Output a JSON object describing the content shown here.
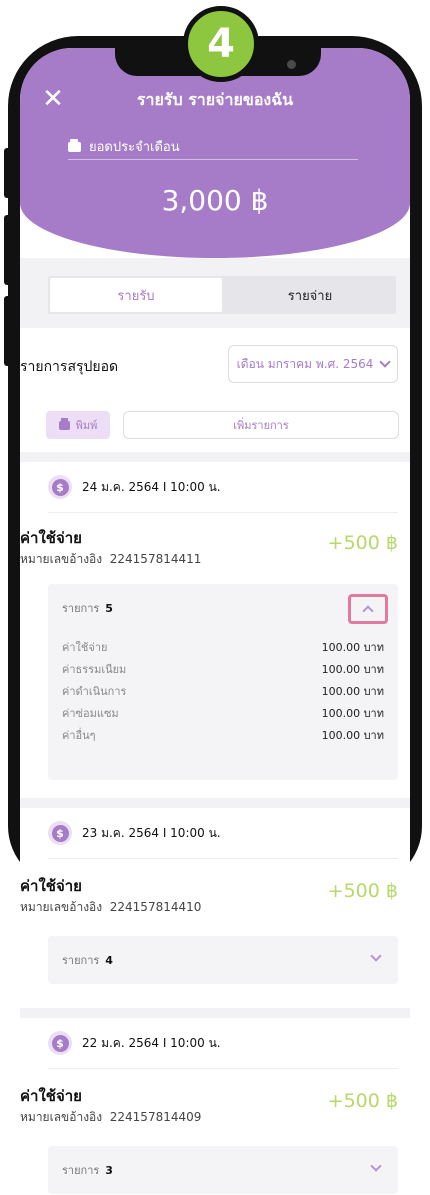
{
  "step_badge": "4",
  "header": {
    "title": "รายรับ รายจ่ายของฉัน",
    "monthly_label": "ยอดประจำเดือน",
    "amount": "3,000 ฿"
  },
  "tabs": [
    {
      "label": "รายรับ",
      "active": true
    },
    {
      "label": "รายจ่าย",
      "active": false
    }
  ],
  "summary": {
    "label": "รายการสรุปยอด",
    "month_selected": "เดือน มกราคม พ.ศ. 2564"
  },
  "actions": {
    "print_label": "พิมพ์",
    "add_label": "เพิ่มรายการ"
  },
  "transactions": [
    {
      "date": "24 ม.ค. 2564  I  10:00 น.",
      "title": "ค่าใช้จ่าย",
      "ref_label": "หมายเลขอ้างอิง",
      "ref_no": "224157814411",
      "amount": "+500 ฿",
      "items_label": "รายการ",
      "items_count": "5",
      "expanded": true,
      "items": [
        {
          "label": "ค่าใช้จ่าย",
          "value": "100.00 บาท"
        },
        {
          "label": "ค่าธรรมเนียม",
          "value": "100.00 บาท"
        },
        {
          "label": "ค่าดำเนินการ",
          "value": "100.00 บาท"
        },
        {
          "label": "ค่าซ่อมแซม",
          "value": "100.00 บาท"
        },
        {
          "label": "ค่าอื่นๆ",
          "value": "100.00 บาท"
        }
      ]
    },
    {
      "date": "23 ม.ค. 2564  I  10:00 น.",
      "title": "ค่าใช้จ่าย",
      "ref_label": "หมายเลขอ้างอิง",
      "ref_no": "224157814410",
      "amount": "+500 ฿",
      "items_label": "รายการ",
      "items_count": "4",
      "expanded": false
    },
    {
      "date": "22 ม.ค. 2564  I  10:00 น.",
      "title": "ค่าใช้จ่าย",
      "ref_label": "หมายเลขอ้างอิง",
      "ref_no": "224157814409",
      "amount": "+500 ฿",
      "items_label": "รายการ",
      "items_count": "3",
      "expanded": false
    }
  ],
  "colors": {
    "primary": "#a67cc8",
    "amount_green": "#b7d96a",
    "badge_green": "#8dc63f",
    "highlight": "#e07a9e"
  }
}
